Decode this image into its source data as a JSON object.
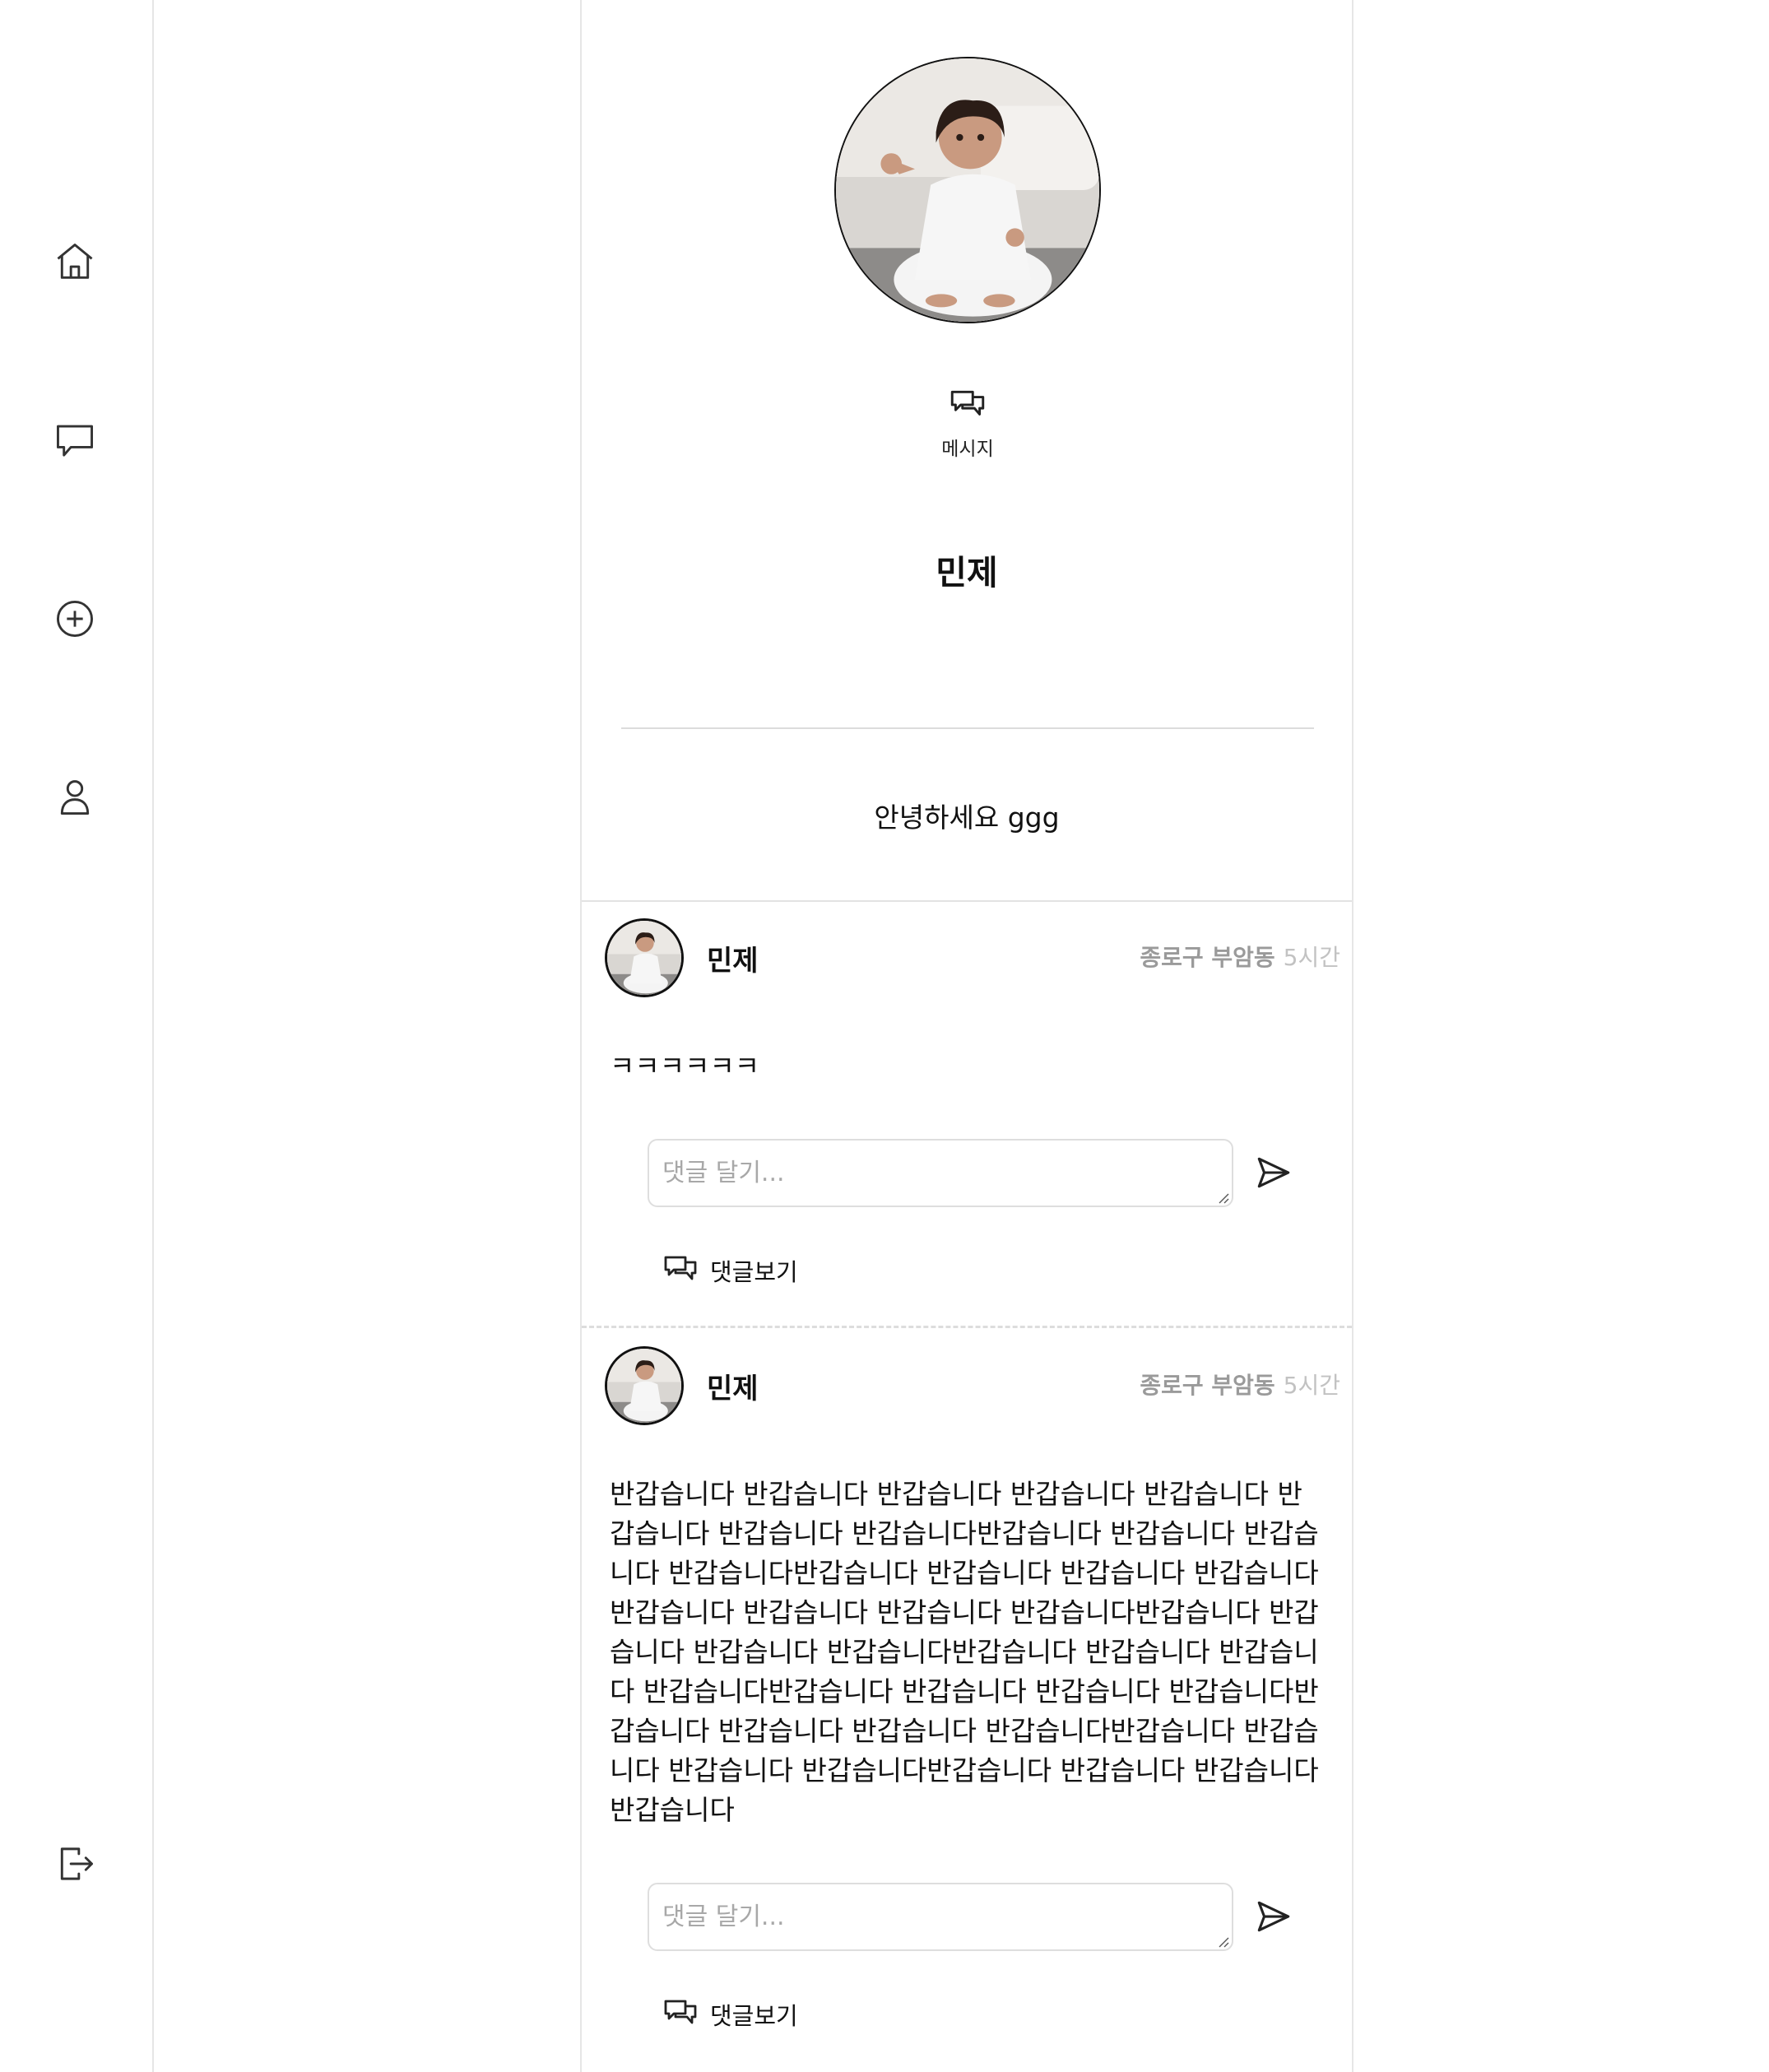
{
  "sidebar": {
    "items": [
      {
        "icon": "home-icon"
      },
      {
        "icon": "chat-icon"
      },
      {
        "icon": "add-circle-icon"
      },
      {
        "icon": "person-icon"
      },
      {
        "icon": "logout-icon"
      }
    ]
  },
  "profile": {
    "message_label": "메시지",
    "name": "민제",
    "bio": "안녕하세요 ggg"
  },
  "posts": [
    {
      "author": "민제",
      "location": "종로구 부암동",
      "time": "5시간",
      "content": "ㅋㅋㅋㅋㅋㅋ",
      "comment_placeholder": "댓글 달기...",
      "view_comments_label": "댓글보기"
    },
    {
      "author": "민제",
      "location": "종로구 부암동",
      "time": "5시간",
      "content": "반갑습니다 반갑습니다 반갑습니다 반갑습니다 반갑습니다 반갑습니다 반갑습니다 반갑습니다반갑습니다 반갑습니다 반갑습니다 반갑습니다반갑습니다 반갑습니다 반갑습니다 반갑습니다반갑습니다 반갑습니다 반갑습니다 반갑습니다반갑습니다 반갑습니다 반갑습니다 반갑습니다반갑습니다 반갑습니다 반갑습니다 반갑습니다반갑습니다 반갑습니다 반갑습니다 반갑습니다반갑습니다 반갑습니다 반갑습니다 반갑습니다반갑습니다 반갑습니다 반갑습니다 반갑습니다반갑습니다 반갑습니다 반갑습니다 반갑습니다",
      "comment_placeholder": "댓글 달기...",
      "view_comments_label": "댓글보기"
    }
  ]
}
